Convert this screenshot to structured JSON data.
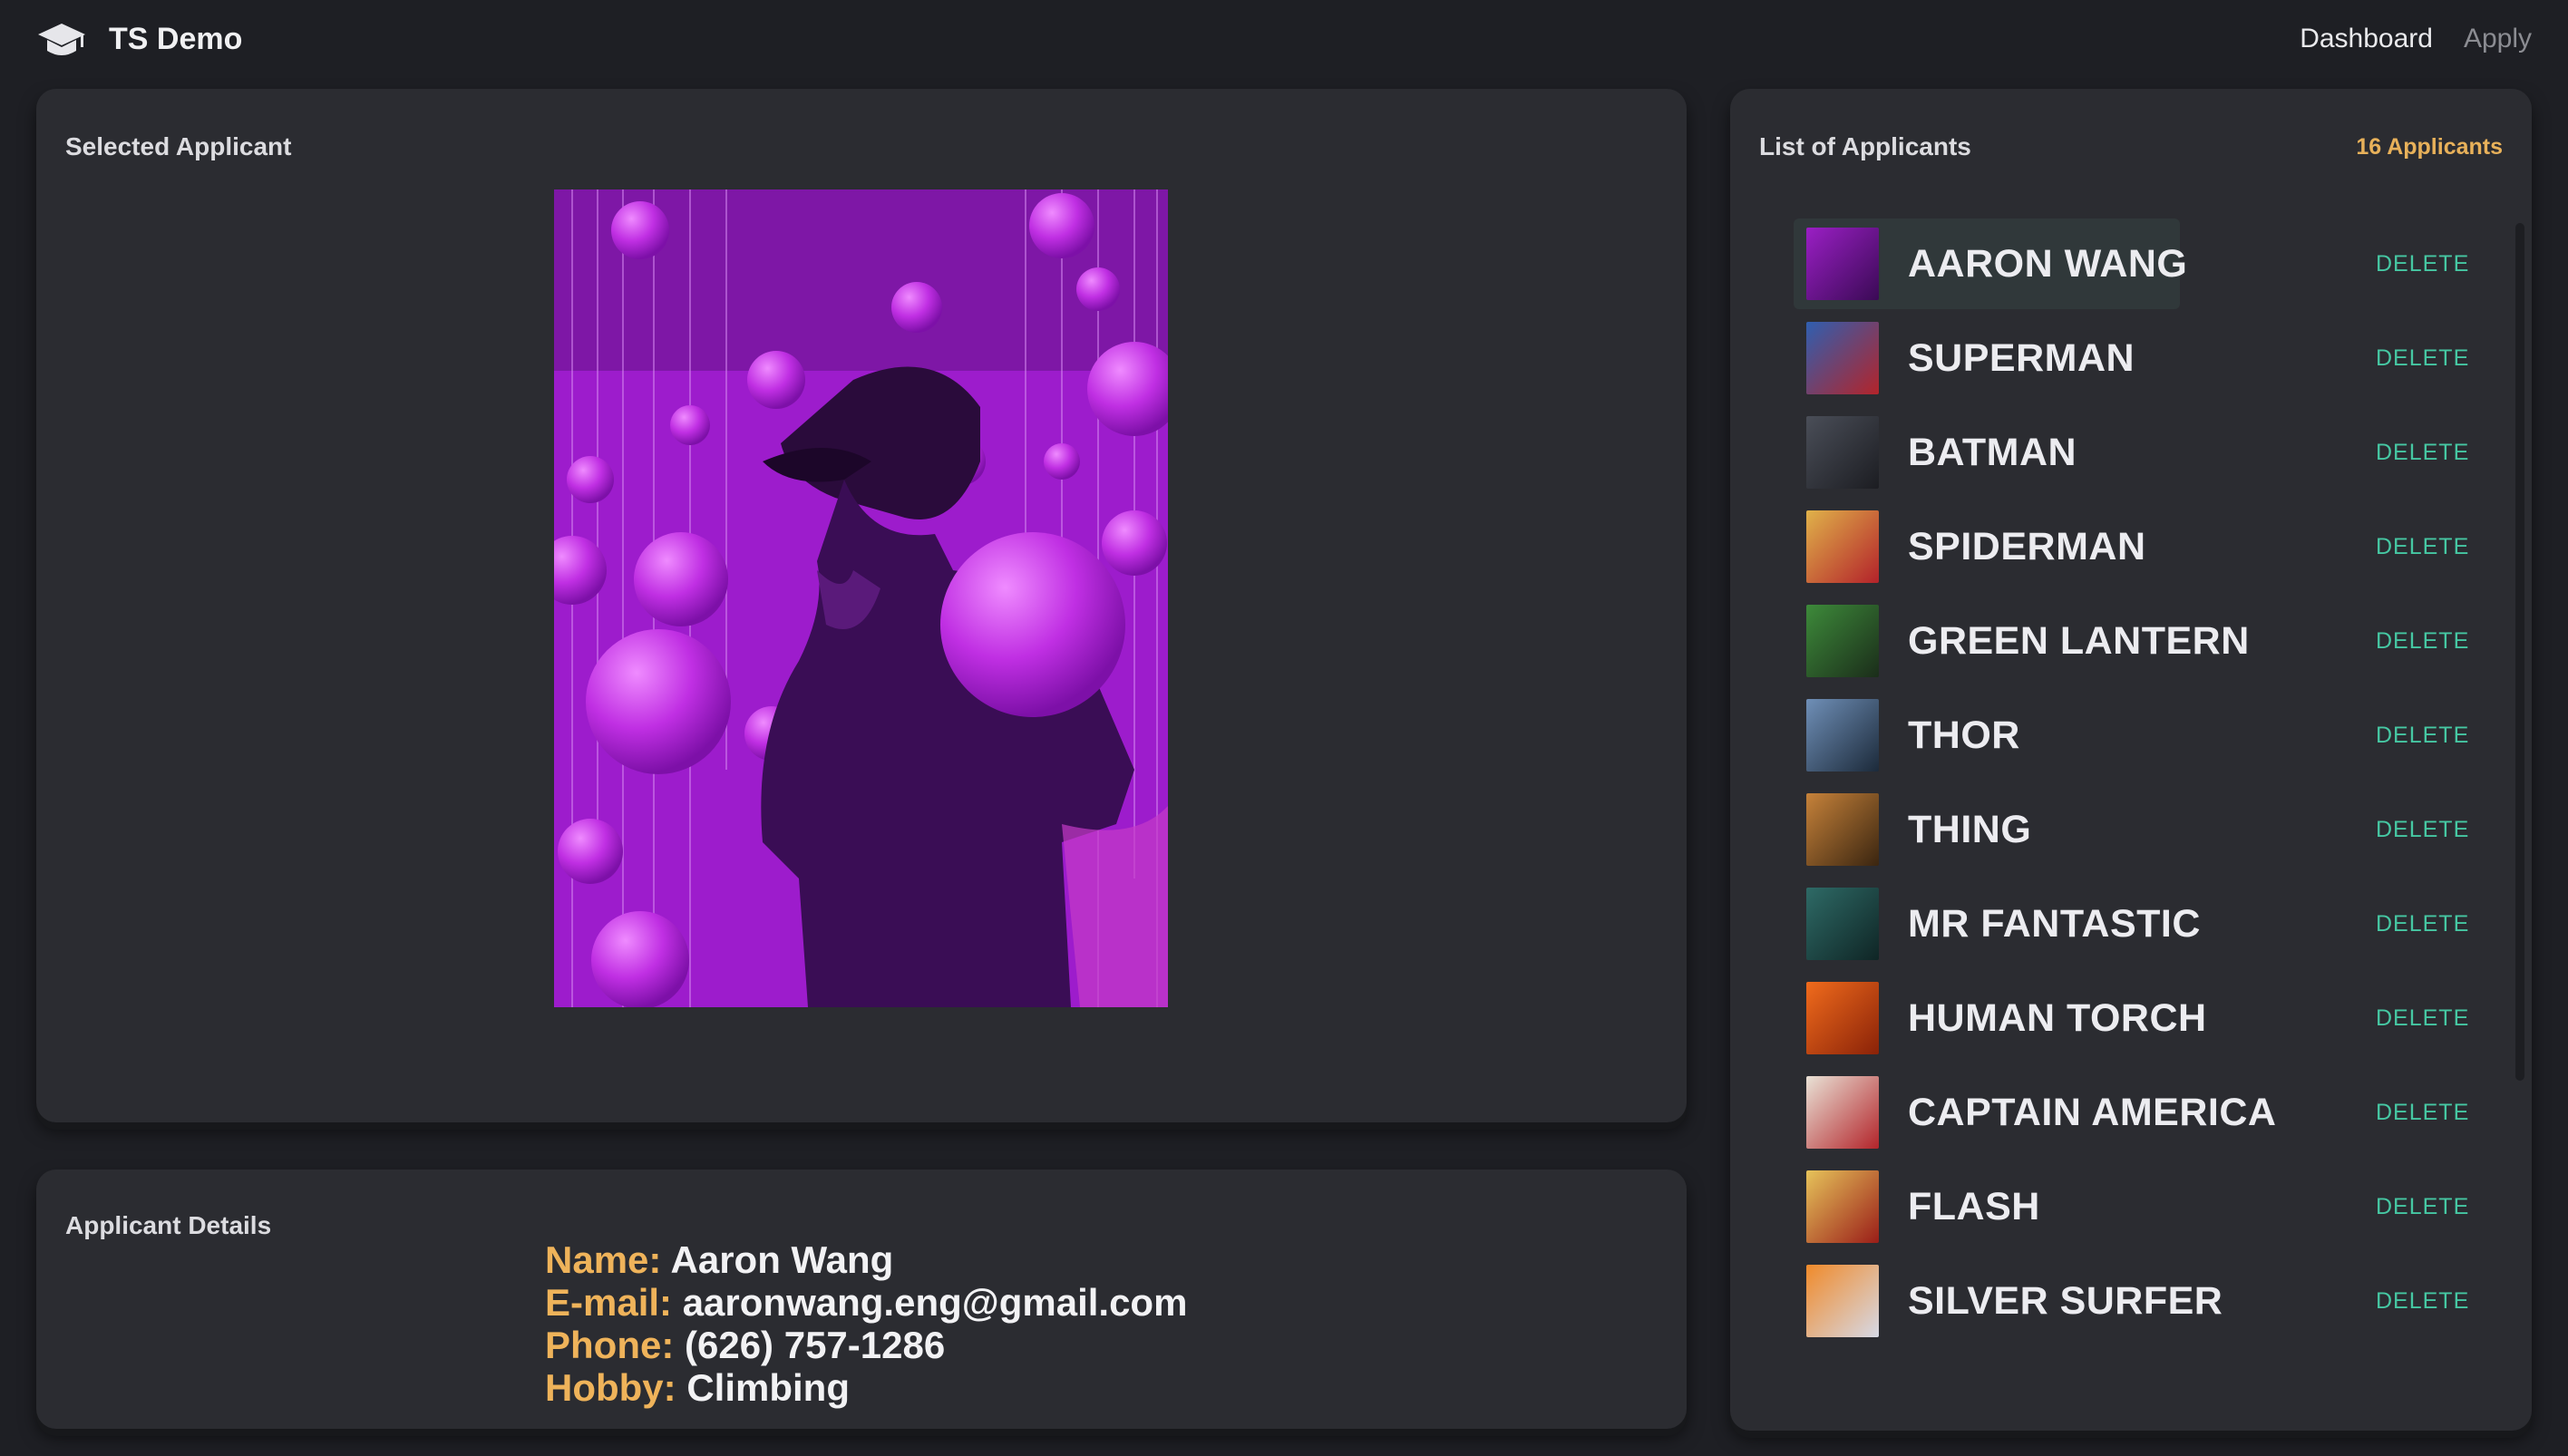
{
  "header": {
    "app_title": "TS Demo",
    "nav": {
      "dashboard": "Dashboard",
      "apply": "Apply"
    }
  },
  "selected": {
    "title": "Selected Applicant"
  },
  "details": {
    "title": "Applicant Details",
    "name_label": "Name:",
    "name": "Aaron Wang",
    "email_label": "E-mail:",
    "email": "aaronwang.eng@gmail.com",
    "phone_label": "Phone:",
    "phone": "(626) 757-1286",
    "hobby_label": "Hobby:",
    "hobby": "Climbing"
  },
  "list": {
    "title": "List of Applicants",
    "count": "16 Applicants",
    "delete_label": "DELETE",
    "items": [
      {
        "name": "AARON WANG",
        "c1": "#9a1fc4",
        "c2": "#3a0a55"
      },
      {
        "name": "SUPERMAN",
        "c1": "#2f5fb0",
        "c2": "#b3242a"
      },
      {
        "name": "BATMAN",
        "c1": "#4a4e58",
        "c2": "#1c1d22"
      },
      {
        "name": "SPIDERMAN",
        "c1": "#e0b24a",
        "c2": "#b3222a"
      },
      {
        "name": "GREEN LANTERN",
        "c1": "#3d8a3a",
        "c2": "#1b2d1a"
      },
      {
        "name": "THOR",
        "c1": "#6f8fb7",
        "c2": "#1c2a3a"
      },
      {
        "name": "THING",
        "c1": "#c6823a",
        "c2": "#3a2510"
      },
      {
        "name": "MR FANTASTIC",
        "c1": "#2e6a66",
        "c2": "#0f2525"
      },
      {
        "name": "HUMAN TORCH",
        "c1": "#f06b1c",
        "c2": "#8a2208"
      },
      {
        "name": "CAPTAIN AMERICA",
        "c1": "#e9e2d6",
        "c2": "#b3242a"
      },
      {
        "name": "FLASH",
        "c1": "#e6c35a",
        "c2": "#9a1d18"
      },
      {
        "name": "SILVER SURFER",
        "c1": "#f08a2a",
        "c2": "#d6d9e6"
      }
    ]
  }
}
